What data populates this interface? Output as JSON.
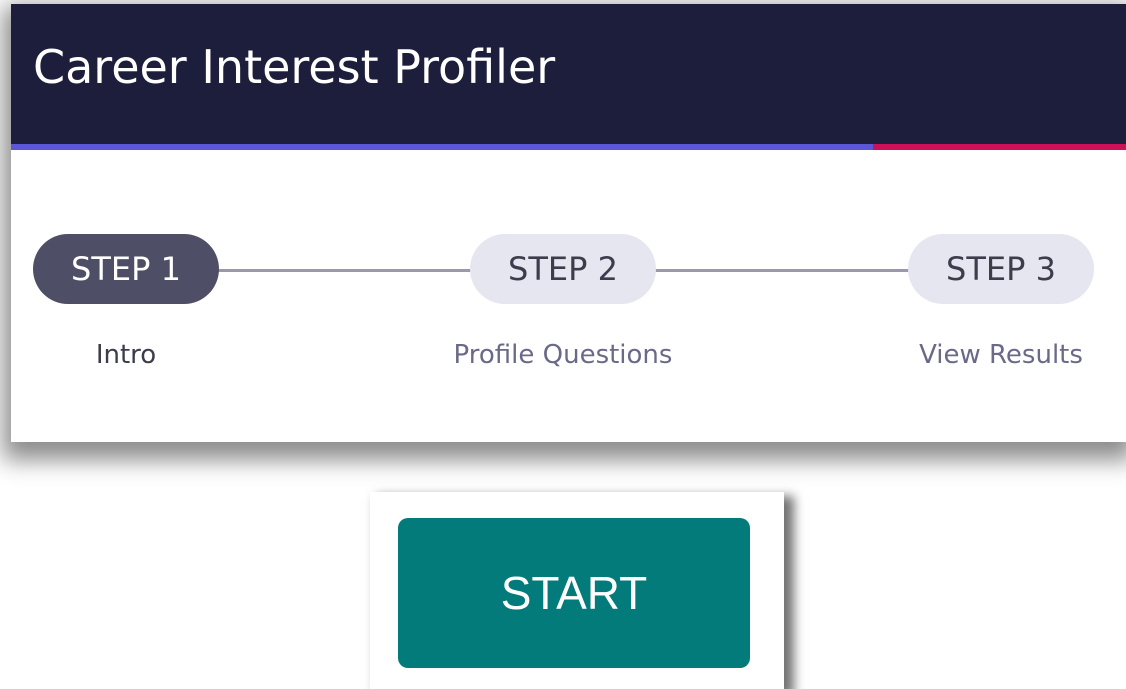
{
  "header": {
    "title": "Career Interest Profiler"
  },
  "theme": {
    "header_bg": "#1d1e3b",
    "accent_primary": "#5d56d8",
    "accent_secondary": "#cf1059",
    "step_active_bg": "#4e4e66",
    "step_inactive_bg": "#e6e6f0",
    "caption_active": "#3c3c4c",
    "caption_inactive": "#6a6a88",
    "start_button_bg": "#037b7b"
  },
  "stepper": {
    "steps": [
      {
        "label": "STEP 1",
        "caption": "Intro",
        "active": true
      },
      {
        "label": "STEP 2",
        "caption": "Profile Questions",
        "active": false
      },
      {
        "label": "STEP 3",
        "caption": "View Results",
        "active": false
      }
    ]
  },
  "start": {
    "label": "START"
  }
}
